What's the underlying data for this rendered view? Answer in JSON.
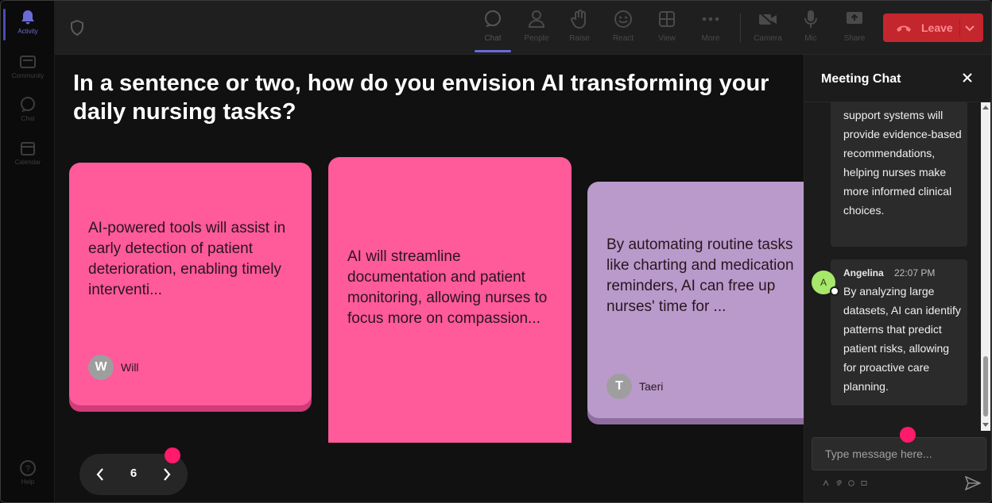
{
  "rail": {
    "items": [
      {
        "id": "activity",
        "label": "Activity",
        "icon": "bell-icon",
        "active": true
      },
      {
        "id": "community",
        "label": "Community",
        "icon": "community-icon",
        "active": false
      },
      {
        "id": "chat",
        "label": "Chat",
        "icon": "chat-icon",
        "active": false
      },
      {
        "id": "calendar",
        "label": "Calendar",
        "icon": "calendar-icon",
        "active": false
      }
    ],
    "help_label": "Help"
  },
  "toolbar": {
    "chat": "Chat",
    "people": "People",
    "raise": "Raise",
    "react": "React",
    "view": "View",
    "more": "More",
    "camera": "Camera",
    "mic": "Mic",
    "share": "Share",
    "leave": "Leave"
  },
  "main": {
    "question": "In a sentence or two, how do you envision AI transforming your daily nursing tasks?",
    "cards": [
      {
        "text": "AI-powered tools will assist in early detection of patient deterioration, enabling timely interventi...",
        "author": "Will",
        "initial": "W"
      },
      {
        "text": "AI will streamline documentation and patient monitoring, allowing nurses to focus more on compassion...",
        "author": "",
        "initial": ""
      },
      {
        "text": "By automating routine tasks like charting and medication reminders, AI can free up nurses' time for ...",
        "author": "Taeri",
        "initial": "T"
      }
    ],
    "pager": {
      "page": "6"
    }
  },
  "chat": {
    "title": "Meeting Chat",
    "messages": [
      {
        "sender": "",
        "time": "",
        "text": "support systems will provide evidence-based recommendations, helping nurses make more informed clinical choices."
      },
      {
        "sender": "Angelina",
        "time": "22:07 PM",
        "initial": "A",
        "text": "By analyzing large datasets, AI can identify patterns that predict patient risks, allowing for proactive care planning."
      }
    ],
    "input_placeholder": "Type message here..."
  },
  "colors": {
    "card_pink": "#ff5a9a",
    "card_purple": "#b99aca",
    "leave_red": "#c4262e",
    "accent": "#6b6bd6",
    "notification_dot": "#ff1a6b",
    "avatar_green": "#a7e86a"
  }
}
